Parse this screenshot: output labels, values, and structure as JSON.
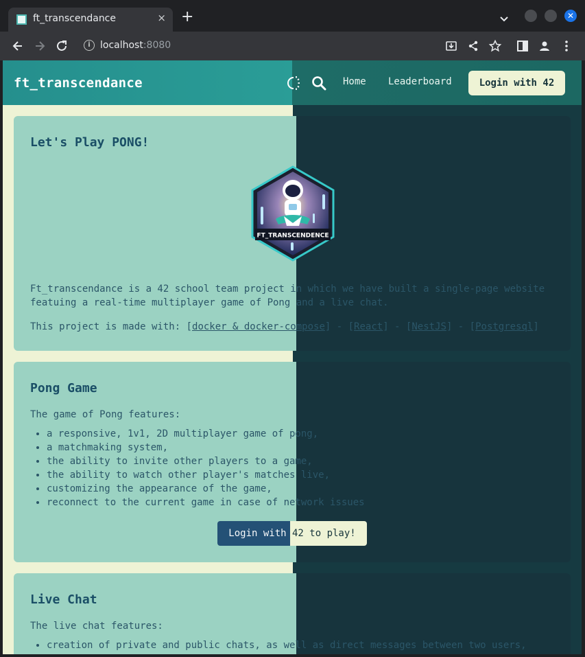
{
  "browser": {
    "tab_title": "ft_transcendance",
    "tab_close": "×",
    "new_tab": "+",
    "address_host": "localhost",
    "address_port": ":8080",
    "info_icon": "i",
    "close_window": "✕"
  },
  "app": {
    "brand": "ft_transcendance",
    "nav": {
      "home": "Home",
      "leaderboard": "Leaderboard",
      "login": "Login with 42"
    },
    "colors": {
      "primary": "#2a9d97",
      "cream": "#eef3d5",
      "card_light": "#9bd2c2",
      "card_dark": "#17343d",
      "title": "#1a4e66"
    }
  },
  "intro": {
    "title": "Let's Play PONG!",
    "logo_text": "FT_TRANSCENDENCE",
    "description": "Ft_transcendance is a 42 school team project in which we have built a single-page website featuing a real-time multiplayer game of Pong and a live chat.",
    "made_prefix": "This project is made with: ",
    "tech": [
      "docker & docker-compose",
      "React",
      "NestJS",
      "Postgresql"
    ]
  },
  "pong": {
    "title": "Pong Game",
    "intro": "The game of Pong features:",
    "features": [
      "a responsive, 1v1, 2D multiplayer game of pong,",
      "a matchmaking system,",
      "the ability to invite other players to a game,",
      "the ability to watch other player's matches live,",
      "customizing the appearance of the game,",
      "reconnect to the current game in case of network issues"
    ],
    "play_button": "Login with 42 to play!"
  },
  "chat": {
    "title": "Live Chat",
    "intro": "The live chat features:",
    "features": [
      "creation of private and public chats, as well as direct messages between two users,"
    ]
  }
}
